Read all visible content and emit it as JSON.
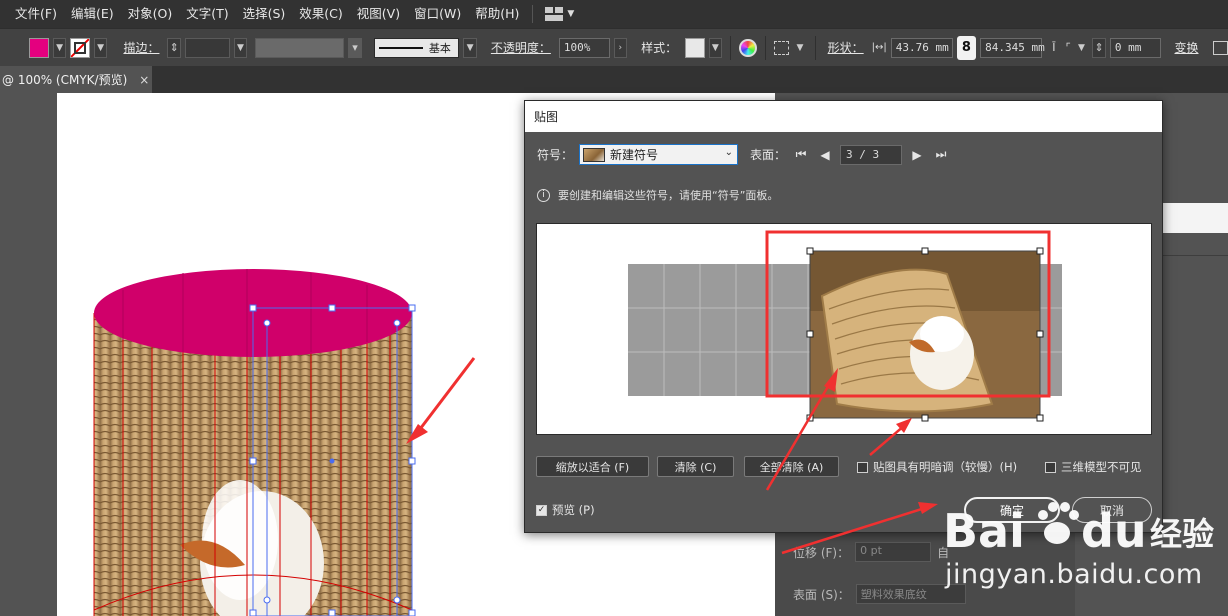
{
  "menubar": {
    "items": [
      "文件(F)",
      "编辑(E)",
      "对象(O)",
      "文字(T)",
      "选择(S)",
      "效果(C)",
      "视图(V)",
      "窗口(W)",
      "帮助(H)"
    ],
    "workspace_icon": "workspace-grid-icon"
  },
  "toolbar": {
    "fill_color": "#e4007f",
    "stroke_label": "描边：",
    "stroke_style": "基本",
    "opacity_label": "不透明度：",
    "opacity_value": "100%",
    "style_label": "样式：",
    "shape_label": "形状：",
    "width_value": "43.76 mm",
    "height_value": "84.345 mm",
    "corner_value": "0 mm",
    "transform_label": "变换"
  },
  "tab": {
    "title": "@ 100% (CMYK/预览)",
    "close": "×"
  },
  "dialog": {
    "title": "贴图",
    "symbol_label": "符号：",
    "symbol_value": "新建符号",
    "surface_label": "表面：",
    "surface_page": "3 / 3",
    "info_text": "要创建和编辑这些符号，请使用“符号”面板。",
    "btn_fit": "缩放以适合 (F)",
    "btn_clear": "清除 (C)",
    "btn_clear_all": "全部清除 (A)",
    "check_shade": "贴图具有明暗调（较慢）(H)",
    "check_invisible": "三维模型不可见",
    "check_preview": "预览 (P)",
    "btn_ok": "确定",
    "btn_cancel": "取消"
  },
  "under_panel": {
    "offset_label": "位移 (F)：",
    "offset_value": "0 pt",
    "offset_suffix": "自",
    "surface_label": "表面 (S)：",
    "surface_value": "塑料效果底纹"
  },
  "watermark": {
    "brand": "Baidu经验",
    "url": "jingyan.baidu.com"
  },
  "colors": {
    "accent": "#e4007f",
    "cylinder_top": "#d0006a",
    "annotation_red": "#f03030",
    "selection_blue": "#4a6cf0"
  }
}
